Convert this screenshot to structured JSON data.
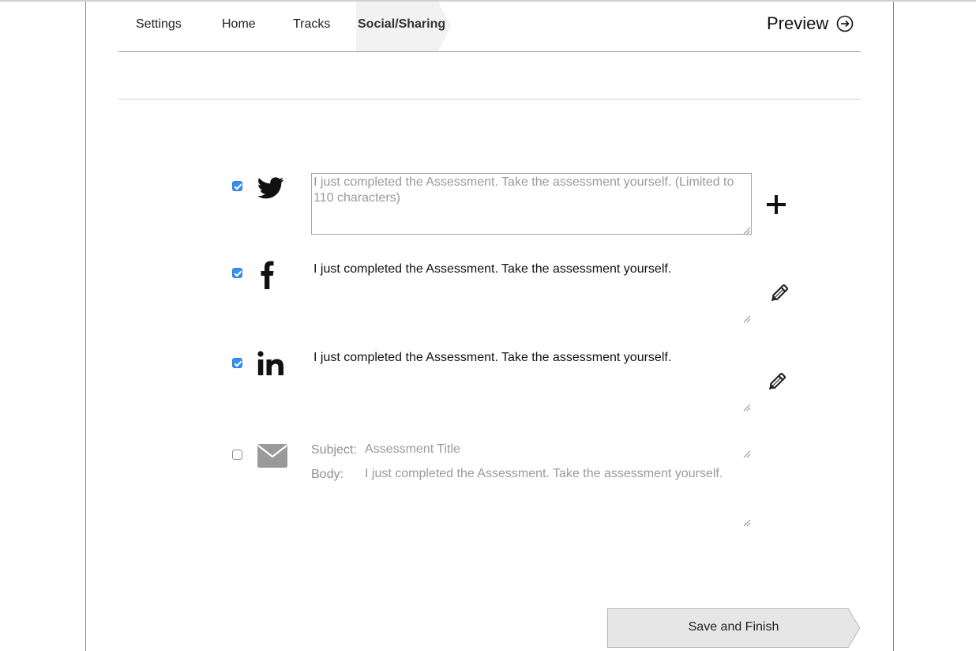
{
  "nav": {
    "tabs": [
      {
        "label": "Settings"
      },
      {
        "label": "Home"
      },
      {
        "label": "Tracks"
      },
      {
        "label": "Social/Sharing",
        "active": true
      }
    ],
    "preview_label": "Preview",
    "preview_icon": "arrow-circle-right-icon"
  },
  "sharing": {
    "twitter": {
      "enabled": true,
      "icon": "twitter-icon",
      "placeholder": "I just completed the Assessment. Take the assessment yourself. (Limited to 110 characters)",
      "action_icon": "plus-icon"
    },
    "facebook": {
      "enabled": true,
      "icon": "facebook-icon",
      "text": "I just completed the Assessment. Take the assessment yourself.",
      "action_icon": "pencil-icon"
    },
    "linkedin": {
      "enabled": true,
      "icon": "linkedin-icon",
      "text": "I just completed the Assessment. Take the assessment yourself.",
      "action_icon": "pencil-icon"
    },
    "email": {
      "enabled": false,
      "icon": "envelope-icon",
      "subject_label": "Subject:",
      "subject_placeholder": "Assessment Title",
      "body_label": "Body:",
      "body_placeholder": "I just completed the Assessment. Take the assessment yourself."
    }
  },
  "footer": {
    "save_label": "Save and Finish"
  },
  "colors": {
    "checkbox_checked": "#3b8ff0",
    "active_tab_bg": "#f2f2f2",
    "button_bg": "#e6e6e6",
    "muted_text": "#9a9a9a"
  }
}
